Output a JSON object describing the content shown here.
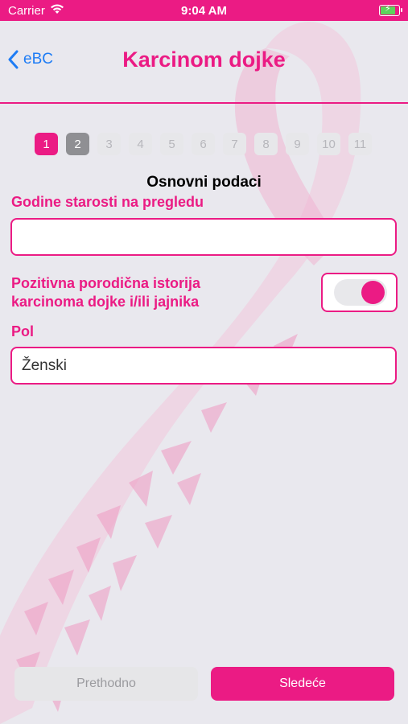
{
  "status": {
    "carrier": "Carrier",
    "time": "9:04 AM"
  },
  "nav": {
    "back_label": "eBC",
    "title": "Karcinom dojke"
  },
  "steps": [
    "1",
    "2",
    "3",
    "4",
    "5",
    "6",
    "7",
    "8",
    "9",
    "10",
    "11"
  ],
  "current_step": 1,
  "section_title": "Osnovni podaci",
  "fields": {
    "age_label": "Godine starosti na pregledu",
    "age_value": "",
    "family_history_label_line1": "Pozitivna porodična istorija",
    "family_history_label_line2": "karcinoma dojke i/ili jajnika",
    "family_history_on": true,
    "sex_label": "Pol",
    "sex_value": "Ženski"
  },
  "buttons": {
    "prev": "Prethodno",
    "next": "Sledeće"
  },
  "colors": {
    "accent": "#eb1b84",
    "link": "#1e7cf5",
    "background": "#e9e8ee"
  }
}
